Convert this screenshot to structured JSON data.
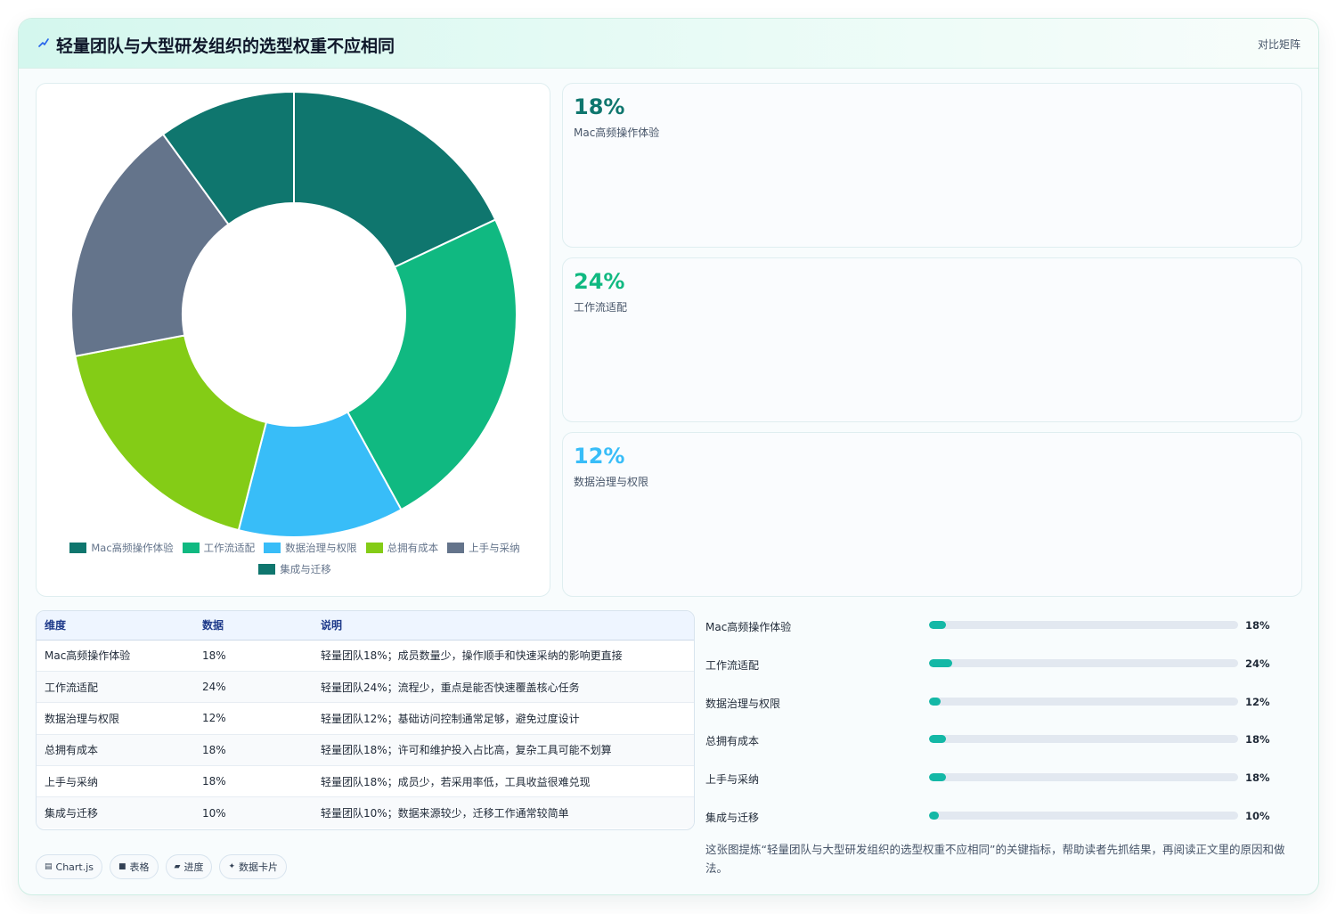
{
  "header": {
    "title": "轻量团队与大型研发组织的选型权重不应相同",
    "link_label": "对比矩阵",
    "icon": "chart-trend-icon"
  },
  "chart_data": {
    "type": "pie",
    "style": "doughnut",
    "categories": [
      "Mac高频操作体验",
      "工作流适配",
      "数据治理与权限",
      "总拥有成本",
      "上手与采纳",
      "集成与迁移"
    ],
    "values": [
      18,
      24,
      12,
      18,
      18,
      10
    ],
    "unit": "%",
    "colors": [
      "#0f766e",
      "#10b981",
      "#38bdf8",
      "#84cc16",
      "#64748b",
      "#0f766e"
    ],
    "legend_position": "bottom"
  },
  "stats": [
    {
      "value": "18%",
      "label": "Mac高频操作体验",
      "color": "#0f766e"
    },
    {
      "value": "24%",
      "label": "工作流适配",
      "color": "#10b981"
    },
    {
      "value": "12%",
      "label": "数据治理与权限",
      "color": "#38bdf8"
    }
  ],
  "table": {
    "headers": [
      "维度",
      "数据",
      "说明"
    ],
    "rows": [
      [
        "Mac高频操作体验",
        "18%",
        "轻量团队18%；成员数量少，操作顺手和快速采纳的影响更直接"
      ],
      [
        "工作流适配",
        "24%",
        "轻量团队24%；流程少，重点是能否快速覆盖核心任务"
      ],
      [
        "数据治理与权限",
        "12%",
        "轻量团队12%；基础访问控制通常足够，避免过度设计"
      ],
      [
        "总拥有成本",
        "18%",
        "轻量团队18%；许可和维护投入占比高，复杂工具可能不划算"
      ],
      [
        "上手与采纳",
        "18%",
        "轻量团队18%；成员少，若采用率低，工具收益很难兑现"
      ],
      [
        "集成与迁移",
        "10%",
        "轻量团队10%；数据来源较少，迁移工作通常较简单"
      ]
    ]
  },
  "progress": [
    {
      "label": "Mac高频操作体验",
      "value": 18,
      "display": "18%"
    },
    {
      "label": "工作流适配",
      "value": 24,
      "display": "24%"
    },
    {
      "label": "数据治理与权限",
      "value": 12,
      "display": "12%"
    },
    {
      "label": "总拥有成本",
      "value": 18,
      "display": "18%"
    },
    {
      "label": "上手与采纳",
      "value": 18,
      "display": "18%"
    },
    {
      "label": "集成与迁移",
      "value": 10,
      "display": "10%"
    }
  ],
  "tags": [
    {
      "icon": "▤",
      "label": "Chart.js"
    },
    {
      "icon": "■",
      "label": "表格"
    },
    {
      "icon": "▰",
      "label": "进度"
    },
    {
      "icon": "✦",
      "label": "数据卡片"
    }
  ],
  "note": "这张图提炼“轻量团队与大型研发组织的选型权重不应相同”的关键指标，帮助读者先抓结果，再阅读正文里的原因和做法。"
}
